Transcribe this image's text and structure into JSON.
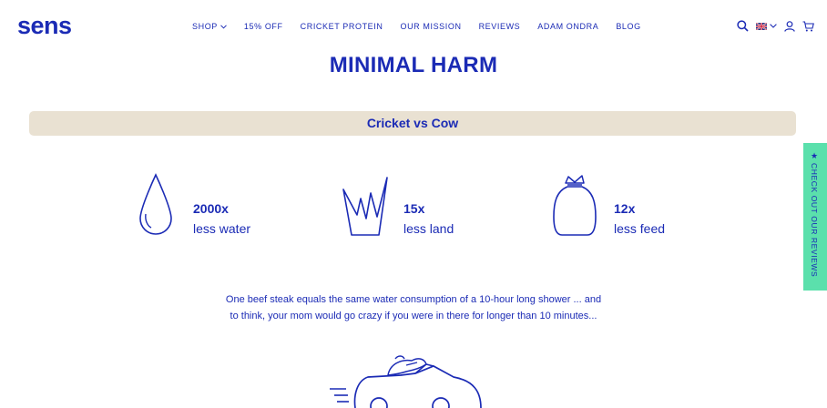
{
  "header": {
    "logo": "sens",
    "nav": [
      {
        "label": "SHOP",
        "has_dropdown": true
      },
      {
        "label": "15% OFF",
        "has_dropdown": false
      },
      {
        "label": "CRICKET PROTEIN",
        "has_dropdown": false
      },
      {
        "label": "OUR MISSION",
        "has_dropdown": false
      },
      {
        "label": "REVIEWS",
        "has_dropdown": false
      },
      {
        "label": "ADAM ONDRA",
        "has_dropdown": false
      },
      {
        "label": "BLOG",
        "has_dropdown": false
      }
    ],
    "icons": [
      "search-icon",
      "uk-flag-icon",
      "chevron-down-icon",
      "user-icon",
      "cart-icon"
    ]
  },
  "main": {
    "title": "MINIMAL HARM",
    "banner": "Cricket vs Cow",
    "stats": [
      {
        "icon": "water-drop-icon",
        "value": "2000x",
        "label": "less water"
      },
      {
        "icon": "land-icon",
        "value": "15x",
        "label": "less land"
      },
      {
        "icon": "feed-bag-icon",
        "value": "12x",
        "label": "less feed"
      }
    ],
    "body_lines": [
      "One beef steak equals the same water consumption of a 10-hour long shower ... and",
      "to think, your mom would go crazy if you were in there for longer than 10 minutes..."
    ],
    "illustration": "cow-driving-car-illustration"
  },
  "review_tab": {
    "label": "CHECK OUT OUR REVIEWS",
    "icon": "star-icon"
  },
  "colors": {
    "brand": "#1b2bb5",
    "banner_bg": "#e9e1d2",
    "review_tab_bg": "#5be0ac"
  }
}
